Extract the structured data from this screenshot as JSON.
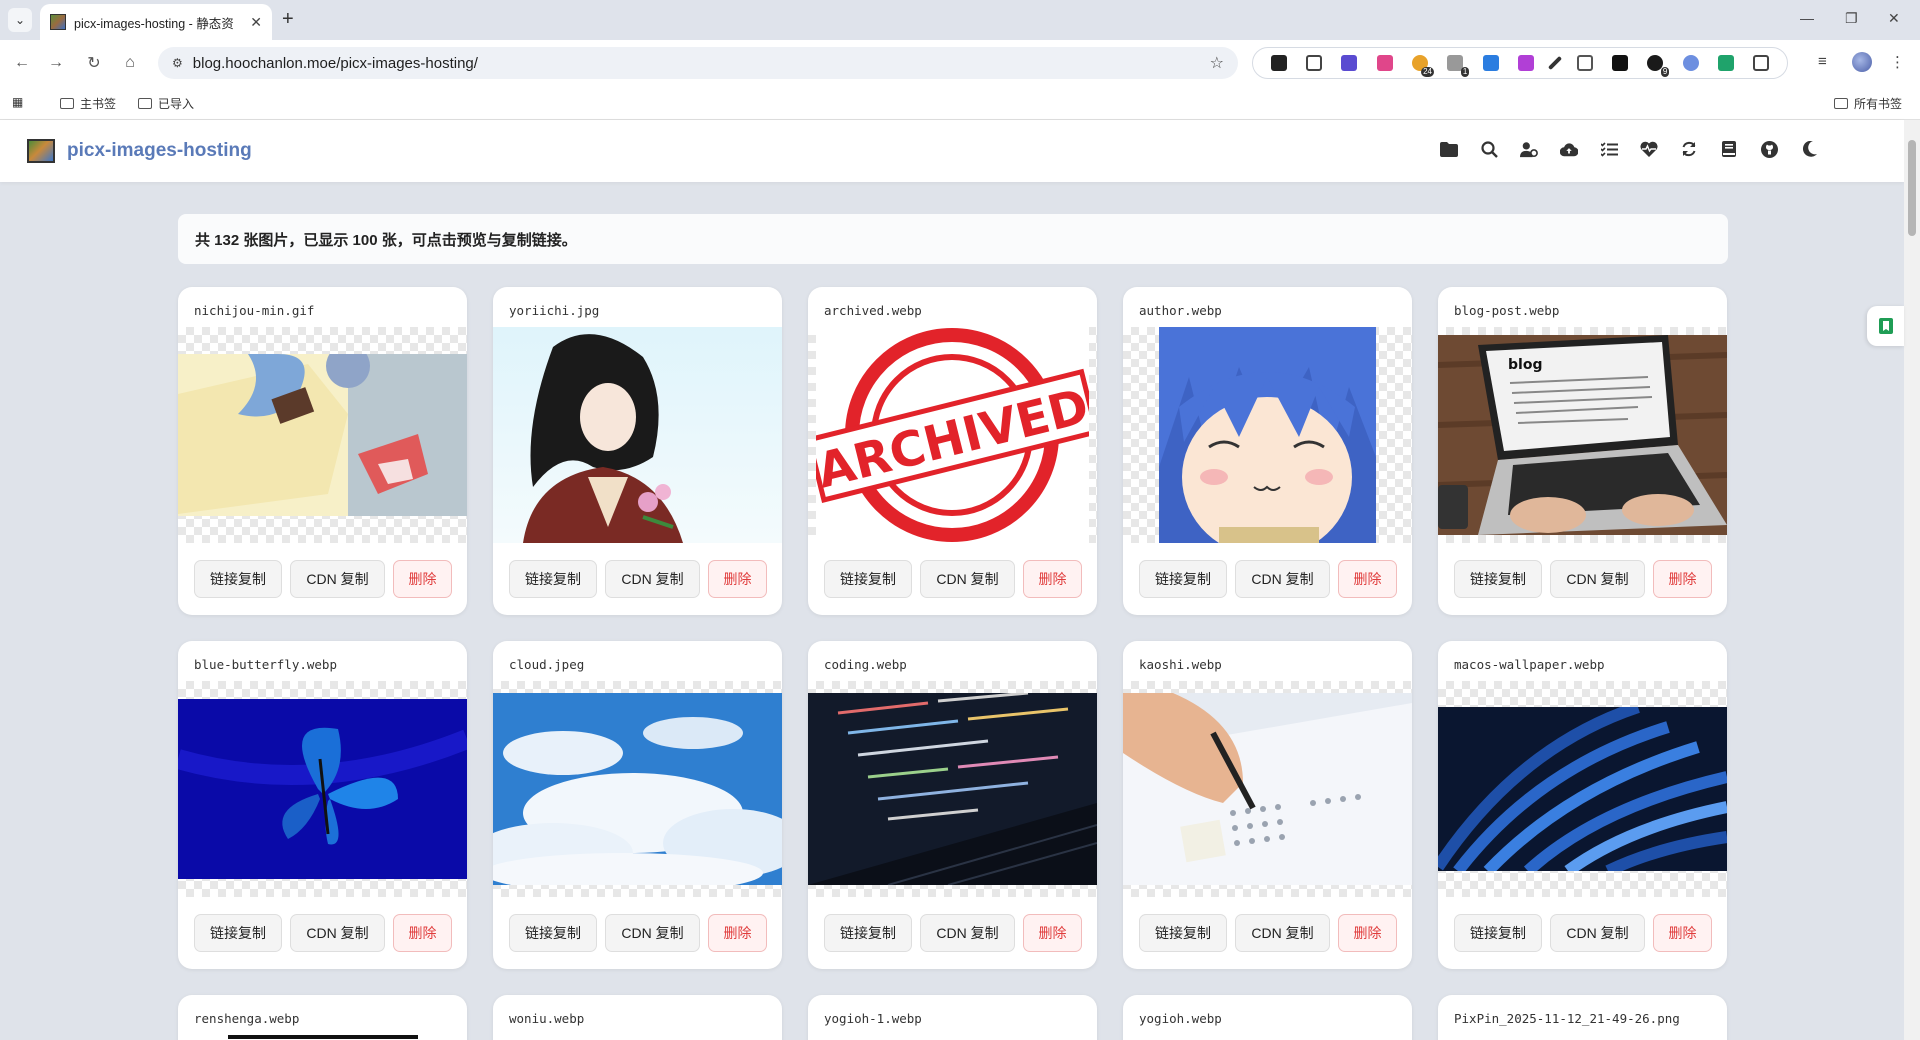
{
  "browser": {
    "tab_title": "picx-images-hosting - 静态资",
    "url": "blog.hoochanlon.moe/picx-images-hosting/",
    "bookmarks": [
      "主书签",
      "已导入"
    ],
    "all_bookmarks": "所有书签",
    "ext_badges": [
      "24",
      "1",
      "9"
    ]
  },
  "app": {
    "title": "picx-images-hosting",
    "header_icons": [
      "folder-icon",
      "search-icon",
      "user-settings-icon",
      "cloud-upload-icon",
      "list-check-icon",
      "heart-pulse-icon",
      "refresh-icon",
      "book-icon",
      "github-icon",
      "moon-icon"
    ]
  },
  "summary": "共 132 张图片，已显示 100 张，可点击预览与复制链接。",
  "labels": {
    "copy_link": "链接复制",
    "cdn_copy": "CDN 复制",
    "delete": "删除"
  },
  "images": [
    {
      "name": "nichijou-min.gif"
    },
    {
      "name": "yoriichi.jpg"
    },
    {
      "name": "archived.webp",
      "stamp": "ARCHIVED"
    },
    {
      "name": "author.webp"
    },
    {
      "name": "blog-post.webp",
      "screen_text": "blog"
    },
    {
      "name": "blue-butterfly.webp"
    },
    {
      "name": "cloud.jpeg"
    },
    {
      "name": "coding.webp"
    },
    {
      "name": "kaoshi.webp"
    },
    {
      "name": "macos-wallpaper.webp"
    },
    {
      "name": "renshenga.webp"
    },
    {
      "name": "woniu.webp"
    },
    {
      "name": "yogioh-1.webp"
    },
    {
      "name": "yogioh.webp"
    },
    {
      "name": "PixPin_2025-11-12_21-49-26.png"
    }
  ]
}
